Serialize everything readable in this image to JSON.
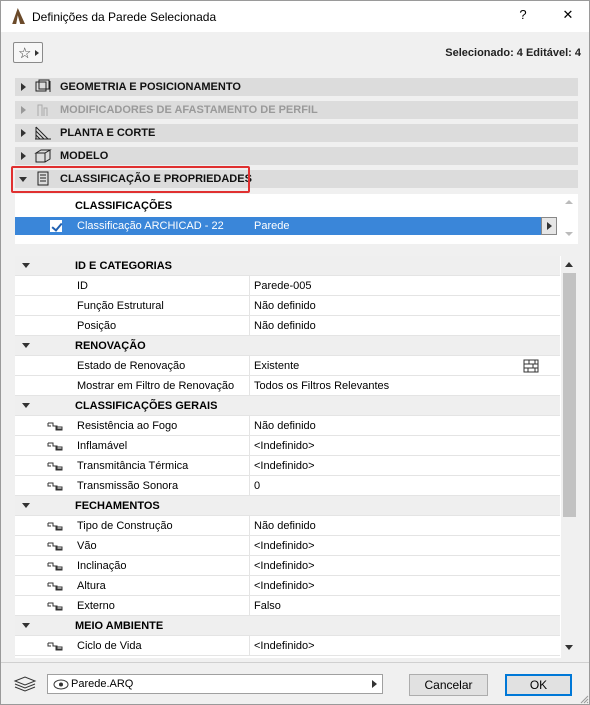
{
  "window": {
    "title": "Definições da Parede Selecionada",
    "help_label": "?",
    "close_label": "✕"
  },
  "toolbar": {
    "selection_info": "Selecionado: 4 Editável: 4"
  },
  "sections": [
    {
      "label": "GEOMETRIA E POSICIONAMENTO",
      "icon": "geometry-icon",
      "expanded": false,
      "enabled": true
    },
    {
      "label": "MODIFICADORES DE AFASTAMENTO DE PERFIL",
      "icon": "profile-modifier-icon",
      "expanded": false,
      "enabled": false
    },
    {
      "label": "PLANTA E CORTE",
      "icon": "floor-plan-icon",
      "expanded": false,
      "enabled": true
    },
    {
      "label": "MODELO",
      "icon": "model-icon",
      "expanded": false,
      "enabled": true
    },
    {
      "label": "CLASSIFICAÇÃO E PROPRIEDADES",
      "icon": "classification-icon",
      "expanded": true,
      "enabled": true
    }
  ],
  "classifications": {
    "header": "CLASSIFICAÇÕES",
    "row": {
      "system": "Classificação ARCHICAD - 22",
      "value": "Parede",
      "checked": true
    }
  },
  "properties": {
    "groups": [
      {
        "label": "ID E CATEGORIAS",
        "rows": [
          {
            "name": "ID",
            "value": "Parede-005",
            "linked": false
          },
          {
            "name": "Função Estrutural",
            "value": "Não definido",
            "linked": false
          },
          {
            "name": "Posição",
            "value": "Não definido",
            "linked": false
          }
        ]
      },
      {
        "label": "RENOVAÇÃO",
        "rows": [
          {
            "name": "Estado de Renovação",
            "value": "Existente",
            "linked": false,
            "extra_icon": "renovation-wall-icon"
          },
          {
            "name": "Mostrar em Filtro de Renovação",
            "value": "Todos os Filtros Relevantes",
            "linked": false
          }
        ]
      },
      {
        "label": "CLASSIFICAÇÕES GERAIS",
        "rows": [
          {
            "name": "Resistência ao Fogo",
            "value": "Não definido",
            "linked": true
          },
          {
            "name": "Inflamável",
            "value": "<Indefinido>",
            "linked": true
          },
          {
            "name": "Transmitância Térmica",
            "value": "<Indefinido>",
            "linked": true
          },
          {
            "name": "Transmissão Sonora",
            "value": "0",
            "linked": true
          }
        ]
      },
      {
        "label": "FECHAMENTOS",
        "rows": [
          {
            "name": "Tipo de Construção",
            "value": "Não definido",
            "linked": true
          },
          {
            "name": "Vão",
            "value": "<Indefinido>",
            "linked": true
          },
          {
            "name": "Inclinação",
            "value": "<Indefinido>",
            "linked": true
          },
          {
            "name": "Altura",
            "value": "<Indefinido>",
            "linked": true
          },
          {
            "name": "Externo",
            "value": "Falso",
            "linked": true
          }
        ]
      },
      {
        "label": "MEIO AMBIENTE",
        "rows": [
          {
            "name": "Ciclo de Vida",
            "value": "<Indefinido>",
            "linked": true
          }
        ]
      }
    ]
  },
  "footer": {
    "favorite": "Parede.ARQ",
    "cancel_label": "Cancelar",
    "ok_label": "OK"
  }
}
